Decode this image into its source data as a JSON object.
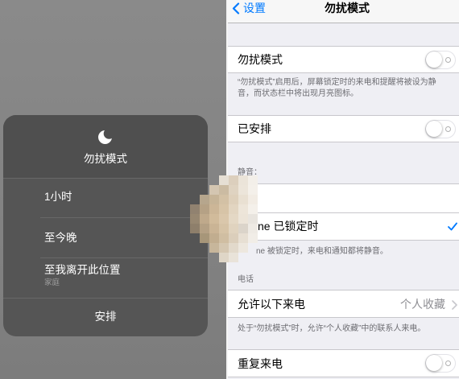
{
  "left_menu": {
    "icon": "moon-icon",
    "title": "勿扰模式",
    "options": [
      {
        "label": "1小时"
      },
      {
        "label": "至今晚"
      },
      {
        "label": "至我离开此位置",
        "sublabel": "家庭"
      }
    ],
    "schedule_label": "安排"
  },
  "settings": {
    "nav": {
      "back_icon": "chevron-left-icon",
      "back_label": "设置",
      "title": "勿扰模式"
    },
    "dnd_row": {
      "label": "勿扰模式",
      "toggle_on": false
    },
    "dnd_description": [
      "“勿扰模式”启用后，屏幕锁定时的来电和提醒将被设为静",
      "音，而状态栏中将出现月亮图标。"
    ],
    "scheduled_row": {
      "label": "已安排",
      "toggle_on": false
    },
    "silence_header": "静音：",
    "locked_row": {
      "label": "ne 已锁定时",
      "selected": true,
      "icon": "checkmark-icon"
    },
    "locked_description": "ne 被锁定时，来电和通知都将静音。",
    "phone_header": "电话",
    "allow_calls_row": {
      "label": "允许以下来电",
      "value": "个人收藏",
      "icon": "chevron-right-icon"
    },
    "allow_calls_description": "处于“勿扰模式”时，允许“个人收藏”中的联系人来电。",
    "repeated_calls_row": {
      "label": "重复来电",
      "toggle_on": false
    }
  },
  "colors": {
    "accent": "#007aff",
    "settings_background": "#efeff4",
    "secondary_text": "#6d6d72",
    "popup_background": "#555555"
  }
}
